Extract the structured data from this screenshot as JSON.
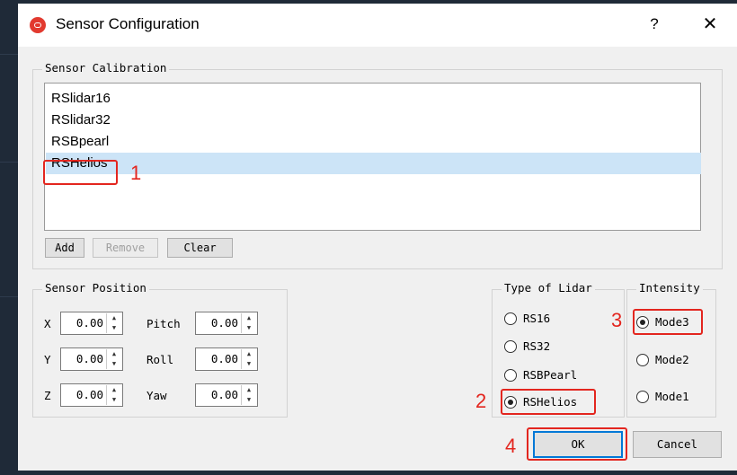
{
  "window": {
    "title": "Sensor Configuration",
    "help_label": "?",
    "close_label": "✕"
  },
  "calibration": {
    "group_title": "Sensor Calibration",
    "items": [
      {
        "label": "RSlidar16"
      },
      {
        "label": "RSlidar32"
      },
      {
        "label": "RSBpearl"
      },
      {
        "label": "RSHelios"
      }
    ],
    "selected": "RSHelios",
    "add_label": "Add",
    "remove_label": "Remove",
    "clear_label": "Clear"
  },
  "position": {
    "group_title": "Sensor Position",
    "x_label": "X",
    "x_value": "0.00",
    "y_label": "Y",
    "y_value": "0.00",
    "z_label": "Z",
    "z_value": "0.00",
    "pitch_label": "Pitch",
    "pitch_value": "0.00",
    "roll_label": "Roll",
    "roll_value": "0.00",
    "yaw_label": "Yaw",
    "yaw_value": "0.00"
  },
  "lidar_type": {
    "group_title": "Type of Lidar",
    "options": [
      {
        "label": "RS16",
        "checked": false
      },
      {
        "label": "RS32",
        "checked": false
      },
      {
        "label": "RSBPearl",
        "checked": false
      },
      {
        "label": "RSHelios",
        "checked": true
      }
    ]
  },
  "intensity": {
    "group_title": "Intensity",
    "options": [
      {
        "label": "Mode3",
        "checked": true
      },
      {
        "label": "Mode2",
        "checked": false
      },
      {
        "label": "Mode1",
        "checked": false
      }
    ]
  },
  "footer": {
    "ok_label": "OK",
    "cancel_label": "Cancel"
  },
  "annotations": {
    "a1": "1",
    "a2": "2",
    "a3": "3",
    "a4": "4"
  },
  "colors": {
    "annotation_red": "#e3261f",
    "selection_blue": "#cce4f7",
    "focus_blue": "#0078d7"
  }
}
